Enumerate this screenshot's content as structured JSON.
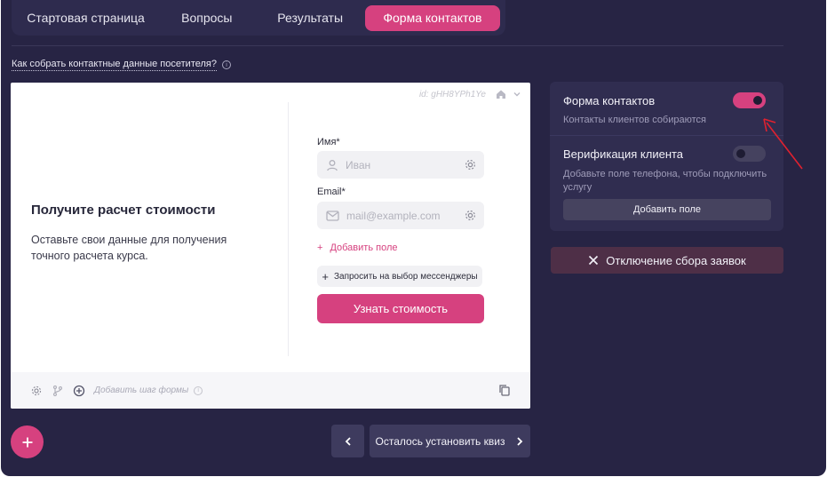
{
  "tabs": [
    {
      "label": "Стартовая страница"
    },
    {
      "label": "Вопросы"
    },
    {
      "label": "Результаты"
    },
    {
      "label": "Форма контактов",
      "active": true
    }
  ],
  "help_link": "Как собрать контактные данные посетителя?",
  "preview": {
    "form_id": "id: gHH8YPh1Ye",
    "title": "Получите расчет стоимости",
    "description": "Оставьте свои данные для получения точного расчета курса.",
    "fields": [
      {
        "label": "Имя*",
        "placeholder": "Иван",
        "icon": "user-icon"
      },
      {
        "label": "Email*",
        "placeholder": "mail@example.com",
        "icon": "mail-icon"
      }
    ],
    "add_field": "Добавить поле",
    "messenger_button": "Запросить на выбор мессенджеры",
    "cta_button": "Узнать стоимость",
    "add_step": "Добавить шаг формы"
  },
  "settings": {
    "contact_form": {
      "title": "Форма контактов",
      "subtitle": "Контакты клиентов собираются",
      "enabled": true
    },
    "verification": {
      "title": "Верификация клиента",
      "subtitle": "Добавьте поле телефона, чтобы подключить услугу",
      "enabled": false
    },
    "add_field_button": "Добавить поле"
  },
  "disable_button": "Отключение сбора заявок",
  "next_button": "Осталось установить квиз",
  "colors": {
    "accent": "#d6417f",
    "background": "#272444",
    "panel": "#302d50",
    "annotation": "#e0212f"
  }
}
